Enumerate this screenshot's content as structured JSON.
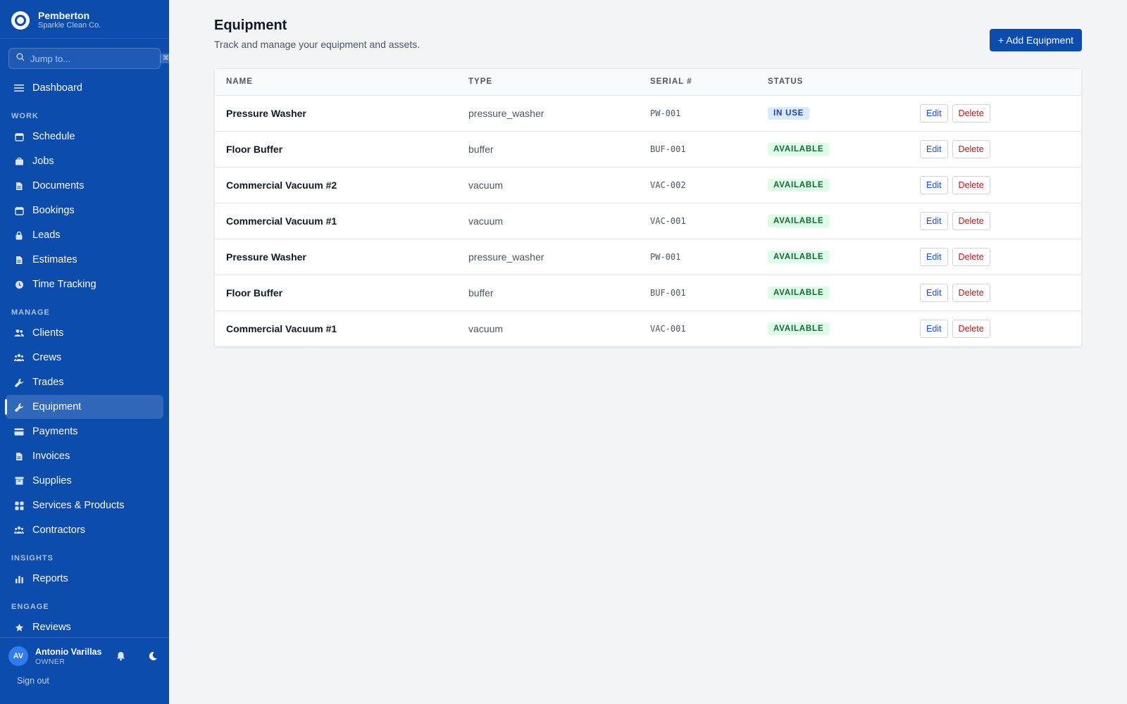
{
  "brand": {
    "name": "Pemberton",
    "sub": "Sparkle Clean Co."
  },
  "search": {
    "placeholder": "Jump to...",
    "shortcut": "⌘K"
  },
  "nav": {
    "dashboard": "Dashboard",
    "sections": {
      "work": "WORK",
      "manage": "MANAGE",
      "insights": "INSIGHTS",
      "engage": "ENGAGE"
    },
    "work": [
      "Schedule",
      "Jobs",
      "Documents",
      "Bookings",
      "Leads",
      "Estimates",
      "Time Tracking"
    ],
    "manage": [
      "Clients",
      "Crews",
      "Trades",
      "Equipment",
      "Payments",
      "Invoices",
      "Supplies",
      "Services & Products",
      "Contractors"
    ],
    "insights": [
      "Reports"
    ],
    "engage": [
      "Reviews"
    ],
    "active": "Equipment"
  },
  "user": {
    "initials": "AV",
    "name": "Antonio Varillas",
    "role": "OWNER",
    "signout": "Sign out"
  },
  "page": {
    "title": "Equipment",
    "subtitle": "Track and manage your equipment and assets.",
    "add_label": "+ Add Equipment"
  },
  "table": {
    "headers": {
      "name": "NAME",
      "type": "TYPE",
      "serial": "SERIAL #",
      "status": "STATUS"
    },
    "edit_label": "Edit",
    "delete_label": "Delete",
    "rows": [
      {
        "name": "Pressure Washer",
        "type": "pressure_washer",
        "serial": "PW-001",
        "status": "IN USE"
      },
      {
        "name": "Floor Buffer",
        "type": "buffer",
        "serial": "BUF-001",
        "status": "AVAILABLE"
      },
      {
        "name": "Commercial Vacuum #2",
        "type": "vacuum",
        "serial": "VAC-002",
        "status": "AVAILABLE"
      },
      {
        "name": "Commercial Vacuum #1",
        "type": "vacuum",
        "serial": "VAC-001",
        "status": "AVAILABLE"
      },
      {
        "name": "Pressure Washer",
        "type": "pressure_washer",
        "serial": "PW-001",
        "status": "AVAILABLE"
      },
      {
        "name": "Floor Buffer",
        "type": "buffer",
        "serial": "BUF-001",
        "status": "AVAILABLE"
      },
      {
        "name": "Commercial Vacuum #1",
        "type": "vacuum",
        "serial": "VAC-001",
        "status": "AVAILABLE"
      }
    ]
  },
  "colors": {
    "sidebar": "#0b4cad",
    "accent": "#0b4cad",
    "inuse_badge": "#dbeafe",
    "available_badge": "#dcfce7"
  }
}
